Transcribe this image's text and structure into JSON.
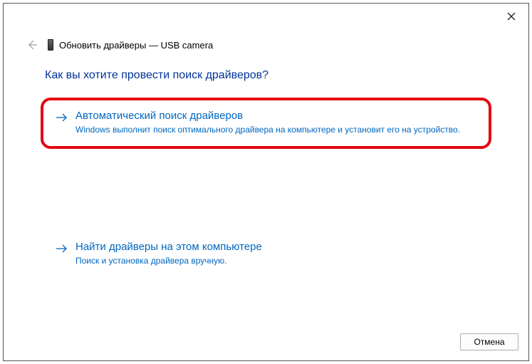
{
  "header": {
    "title": "Обновить драйверы — USB camera"
  },
  "question": "Как вы хотите провести поиск драйверов?",
  "options": {
    "auto": {
      "title": "Автоматический поиск драйверов",
      "desc": "Windows выполнит поиск оптимального драйвера на компьютере и установит его на устройство."
    },
    "manual": {
      "title": "Найти драйверы на этом компьютере",
      "desc": "Поиск и установка драйвера вручную."
    }
  },
  "footer": {
    "cancel": "Отмена"
  },
  "colors": {
    "link": "#0067c0",
    "highlight": "#e30613"
  }
}
